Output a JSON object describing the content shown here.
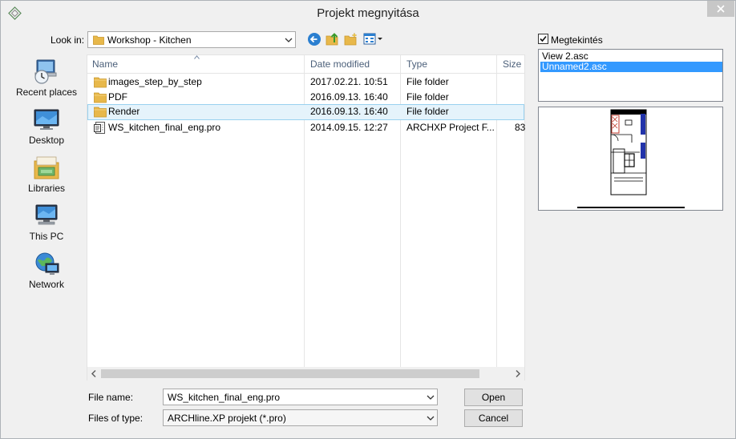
{
  "window": {
    "title": "Projekt megnyitása"
  },
  "lookin": {
    "label": "Look in:",
    "value": "Workshop - Kitchen"
  },
  "places": [
    {
      "label": "Recent places",
      "icon": "recent-places-icon"
    },
    {
      "label": "Desktop",
      "icon": "desktop-icon"
    },
    {
      "label": "Libraries",
      "icon": "libraries-icon"
    },
    {
      "label": "This PC",
      "icon": "this-pc-icon"
    },
    {
      "label": "Network",
      "icon": "network-icon"
    }
  ],
  "columns": {
    "name": "Name",
    "date": "Date modified",
    "type": "Type",
    "size": "Size"
  },
  "files": [
    {
      "name": "images_step_by_step",
      "date": "2017.02.21. 10:51",
      "type": "File folder",
      "size": "",
      "icon": "folder-icon"
    },
    {
      "name": "PDF",
      "date": "2016.09.13. 16:40",
      "type": "File folder",
      "size": "",
      "icon": "folder-icon"
    },
    {
      "name": "Render",
      "date": "2016.09.13. 16:40",
      "type": "File folder",
      "size": "",
      "icon": "folder-icon"
    },
    {
      "name": "WS_kitchen_final_eng.pro",
      "date": "2014.09.15. 12:27",
      "type": "ARCHXP Project F...",
      "size": "83",
      "icon": "project-file-icon"
    }
  ],
  "filename": {
    "label": "File name:",
    "value": "WS_kitchen_final_eng.pro"
  },
  "filetype": {
    "label": "Files of type:",
    "value": "ARCHline.XP projekt (*.pro)"
  },
  "buttons": {
    "open": "Open",
    "cancel": "Cancel"
  },
  "preview": {
    "checkbox_label": "Megtekintés",
    "checked": true,
    "views": [
      "View 2.asc",
      "Unnamed2.asc"
    ],
    "selected_view": "Unnamed2.asc"
  },
  "colors": {
    "selection": "#3399ff",
    "row_highlight": "#e5f3fb",
    "folder": "#e8b84a"
  }
}
